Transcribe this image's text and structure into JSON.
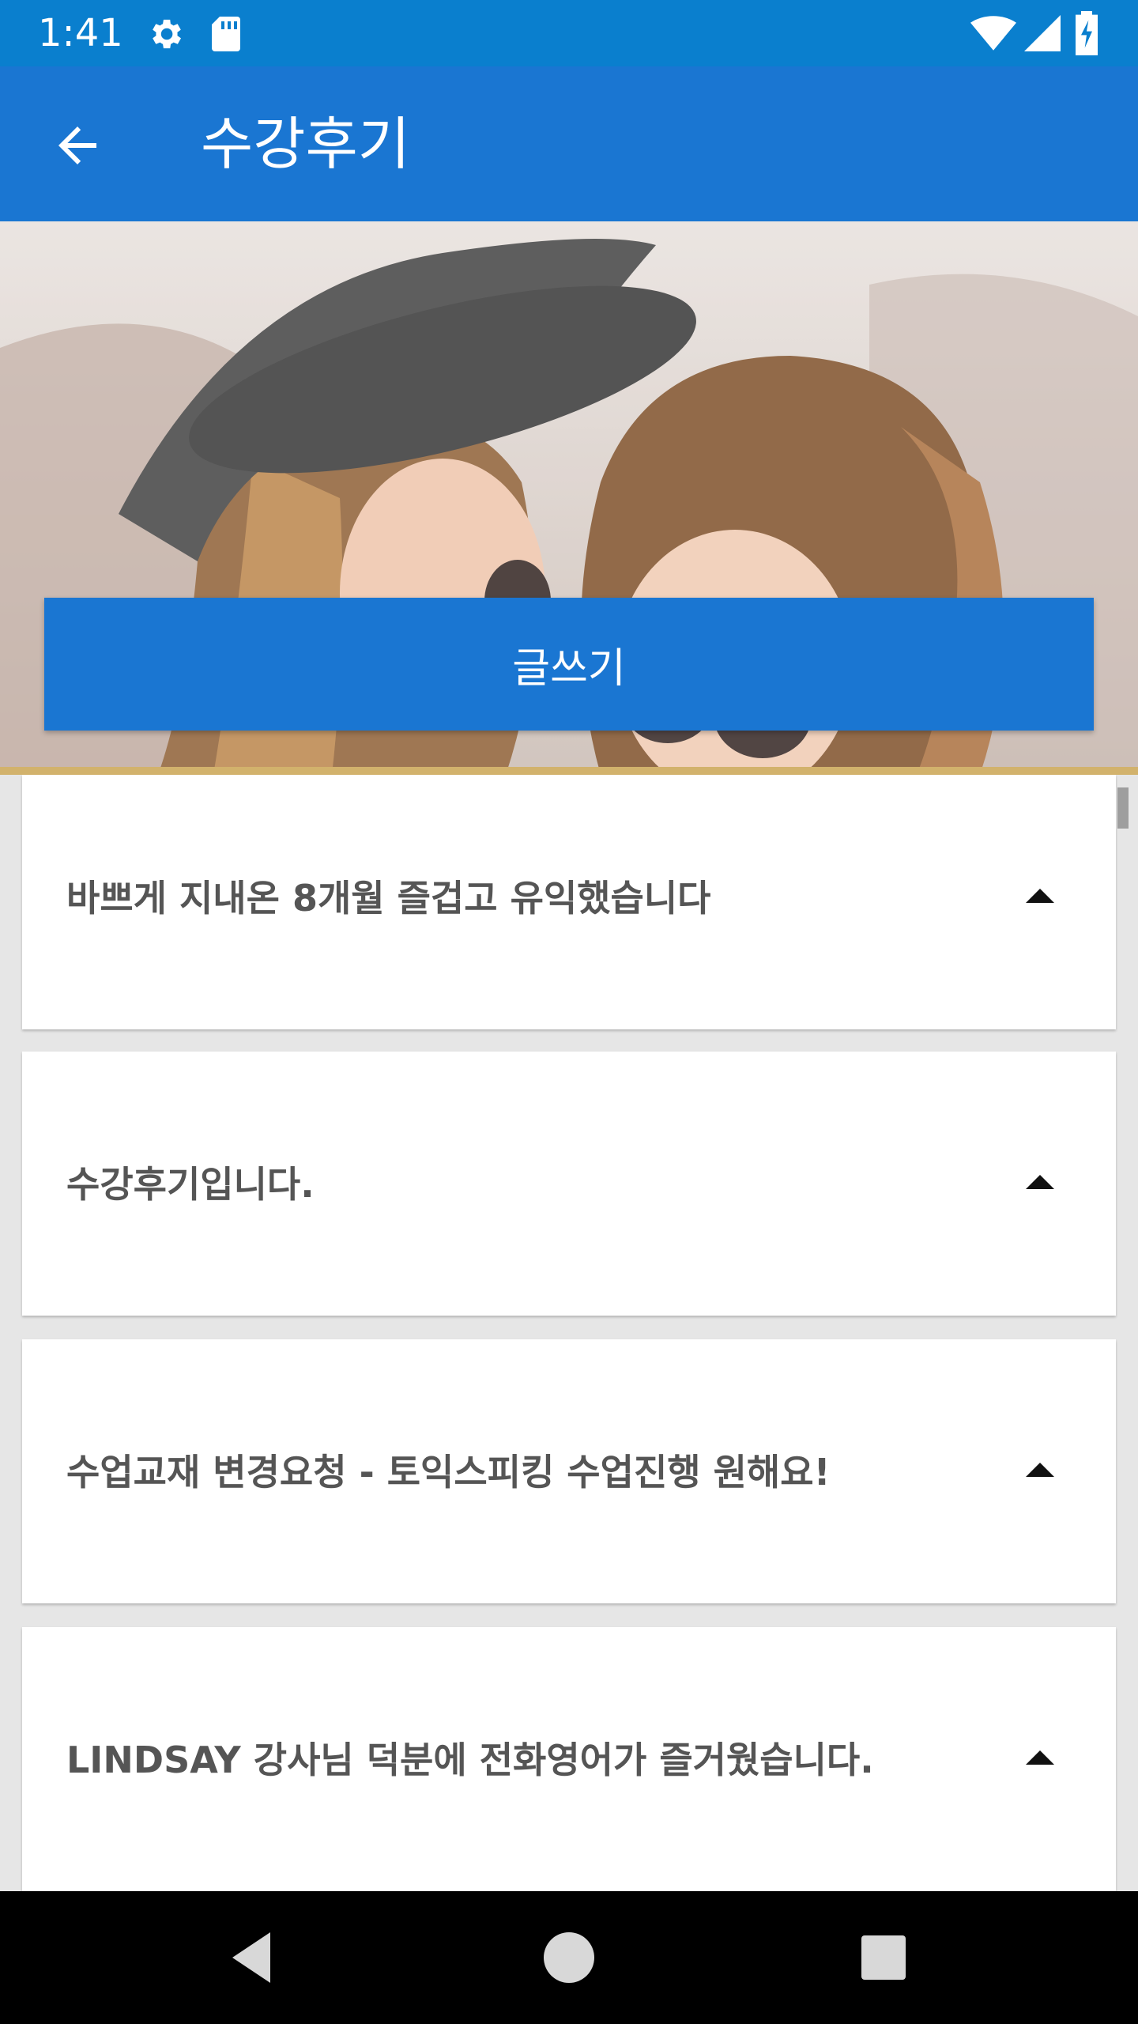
{
  "status_bar": {
    "time": "1:41",
    "icons": [
      "settings-icon",
      "sd-card-icon",
      "wifi-icon",
      "signal-icon",
      "battery-charging-icon"
    ]
  },
  "app_bar": {
    "title": "수강후기",
    "back_icon": "arrow-left-icon"
  },
  "hero": {
    "image": "two-smiling-women-photo",
    "write_button_label": "글쓰기"
  },
  "reviews": [
    {
      "title": "바쁘게 지내온 8개월 즐겁고 유익했습니다"
    },
    {
      "title": "수강후기입니다."
    },
    {
      "title": "수업교재 변경요청 - 토익스피킹 수업진행 원해요!"
    },
    {
      "title": "LINDSAY 강사님 덕분에 전화영어가 즐거웠습니다."
    }
  ],
  "nav_bar": {
    "icons": [
      "back-triangle-icon",
      "home-circle-icon",
      "recents-square-icon"
    ]
  },
  "colors": {
    "status_bar": "#0a7fce",
    "app_bar": "#1a76d2",
    "button": "#1a76d2",
    "background": "#e6e6e6"
  }
}
